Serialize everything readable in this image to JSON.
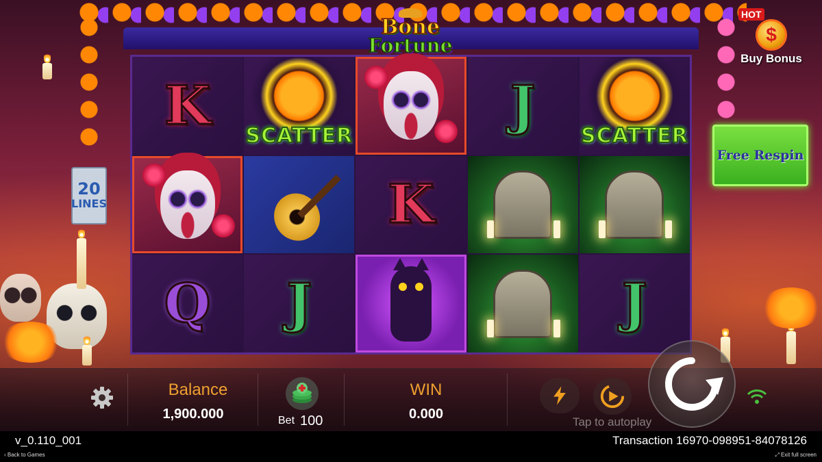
{
  "game": {
    "logo_line1": "Bone",
    "logo_line2": "Fortune",
    "lines_count": "20",
    "lines_label": "LINES"
  },
  "buy_bonus": {
    "badge": "HOT",
    "coin_symbol": "$",
    "label": "Buy Bonus"
  },
  "free_respin": {
    "label": "Free Respin"
  },
  "reels": {
    "rows": [
      [
        "K",
        "SCATTER",
        "lady",
        "J",
        "SCATTER"
      ],
      [
        "lady",
        "guitar",
        "K",
        "gravestone",
        "gravestone"
      ],
      [
        "Q",
        "J",
        "cat",
        "gravestone",
        "J"
      ]
    ],
    "scatter_label": "SCATTER"
  },
  "bottom_bar": {
    "balance_label": "Balance",
    "balance_value": "1,900.000",
    "bet_label": "Bet",
    "bet_value": "100",
    "win_label": "WIN",
    "win_value": "0.000",
    "autoplay_hint": "Tap to autoplay"
  },
  "footer": {
    "version": "v_0.110_001",
    "transaction": "Transaction 16970-098951-84078126",
    "back_link": "Back to Games",
    "exit_link": "Exit full screen"
  },
  "colors": {
    "label_orange": "#f0a030",
    "scatter_green": "#a6f53a",
    "free_respin_green": "#3ab020",
    "frame_blue": "#3a2a9e"
  },
  "icons": {
    "settings": "gear-icon",
    "bet": "coin-stack-plus-icon",
    "turbo": "lightning-icon",
    "autoplay": "autoplay-play-icon",
    "spin": "spin-arrow-icon",
    "connection": "wifi-icon"
  }
}
